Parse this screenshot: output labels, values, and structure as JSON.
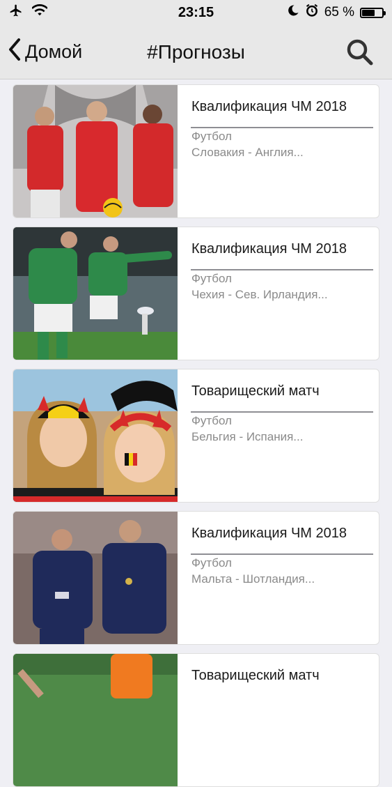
{
  "status_bar": {
    "time": "23:15",
    "battery_text": "65 %",
    "battery_level": 0.65,
    "icons": [
      "airplane-icon",
      "wifi-icon",
      "moon-icon",
      "alarm-icon",
      "battery-icon"
    ]
  },
  "nav": {
    "back_label": "Домой",
    "title": "#Прогнозы",
    "search_icon": "search-icon"
  },
  "cards": [
    {
      "title": "Квалификация ЧМ 2018",
      "sport": "Футбол",
      "match": "Словакия - Англия...",
      "image": "england-players-photo"
    },
    {
      "title": "Квалификация ЧМ 2018",
      "sport": "Футбол",
      "match": "Чехия - Сев. Ирландия...",
      "image": "northern-ireland-players-photo"
    },
    {
      "title": "Товарищеский матч",
      "sport": "Футбол",
      "match": "Бельгия - Испания...",
      "image": "belgium-fans-photo"
    },
    {
      "title": "Квалификация ЧМ 2018",
      "sport": "Футбол",
      "match": "Мальта - Шотландия...",
      "image": "scotland-players-photo"
    },
    {
      "title": "Товарищеский матч",
      "sport": "",
      "match": "",
      "image": "netherlands-player-photo"
    }
  ],
  "colors": {
    "bar_bg": "#e8e8e8",
    "page_bg": "#efeff4",
    "divider": "#8e8e93",
    "muted_text": "#8a8a8a"
  }
}
